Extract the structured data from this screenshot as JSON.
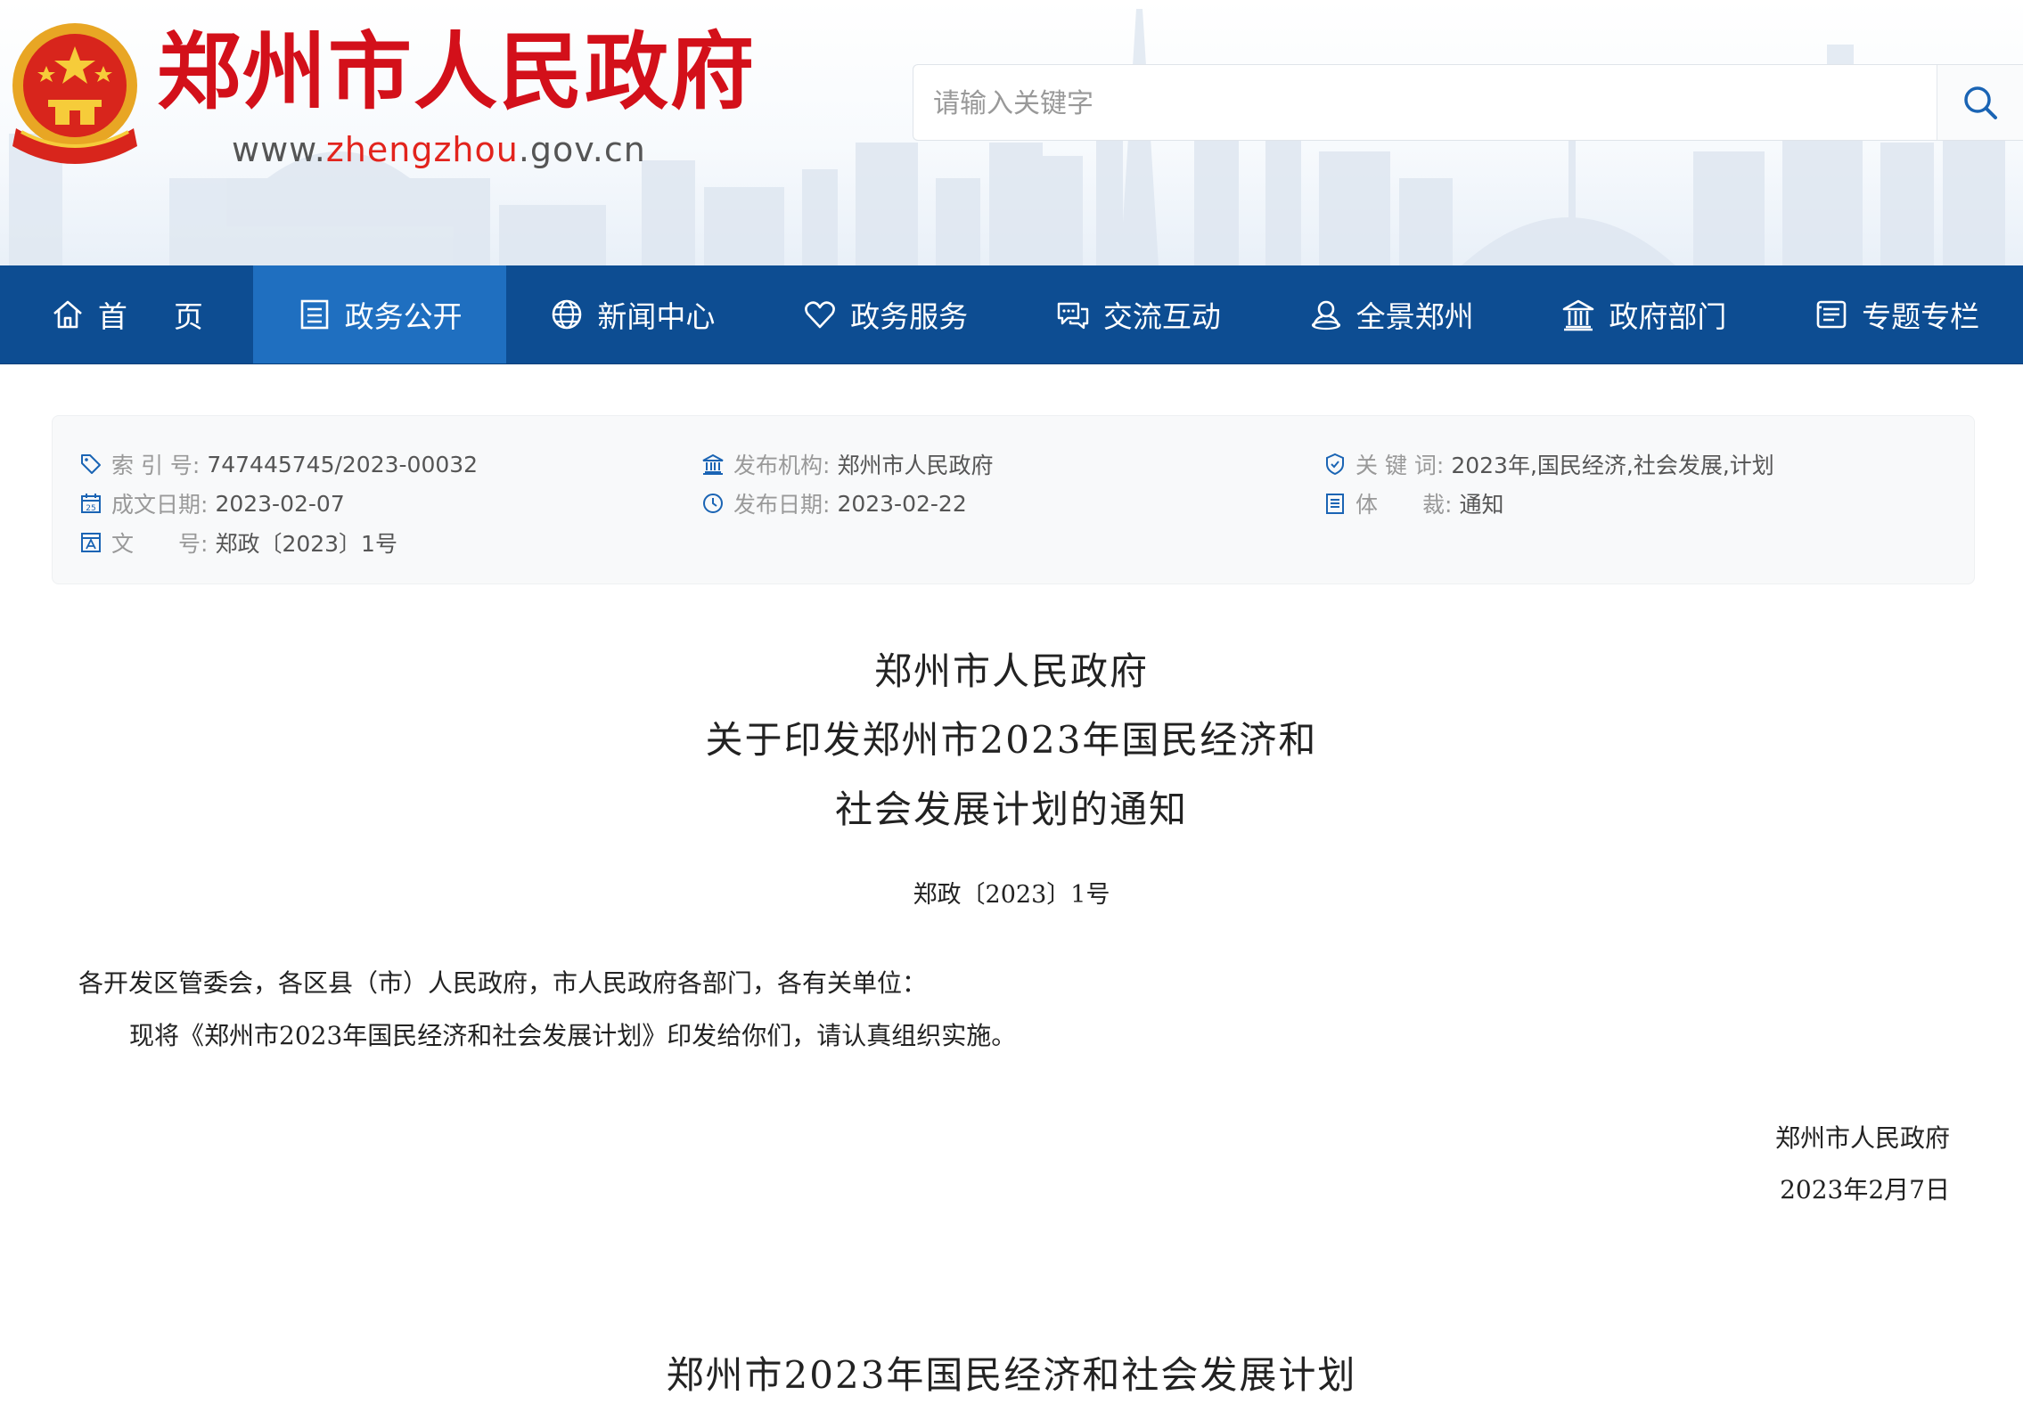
{
  "header": {
    "site_title": "郑州市人民政府",
    "url_prefix": "www.",
    "url_highlight": "zhengzhou",
    "url_suffix": ".gov.cn",
    "brand_red": "#d3101a"
  },
  "search": {
    "placeholder": "请输入关键字",
    "value": "",
    "icon": "search-icon"
  },
  "nav": {
    "bg_color": "#0d4d92",
    "active_color": "#1f6fc0",
    "items": [
      {
        "label": "首页",
        "icon": "home-icon"
      },
      {
        "label": "政务公开",
        "icon": "document-list-icon",
        "active": true
      },
      {
        "label": "新闻中心",
        "icon": "globe-icon"
      },
      {
        "label": "政务服务",
        "icon": "heart-icon"
      },
      {
        "label": "交流互动",
        "icon": "chat-bubbles-icon"
      },
      {
        "label": "全景郑州",
        "icon": "panorama-person-icon"
      },
      {
        "label": "政府部门",
        "icon": "government-building-icon"
      },
      {
        "label": "专题专栏",
        "icon": "columns-list-icon"
      }
    ]
  },
  "meta": {
    "index_label": "索 引 号:",
    "index_value": "747445745/2023-00032",
    "date_written_label": "成文日期:",
    "date_written_value": "2023-02-07",
    "doc_number_label": "文　　号:",
    "doc_number_value": "郑政〔2023〕1号",
    "publisher_label": "发布机构:",
    "publisher_value": "郑州市人民政府",
    "publish_date_label": "发布日期:",
    "publish_date_value": "2023-02-22",
    "keywords_label": "关 键 词:",
    "keywords_value": "2023年,国民经济,社会发展,计划",
    "genre_label": "体　　裁:",
    "genre_value": "通知"
  },
  "article": {
    "title_line1": "郑州市人民政府",
    "title_line2": "关于印发郑州市2023年国民经济和",
    "title_line3": "社会发展计划的通知",
    "doc_number": "郑政〔2023〕1号",
    "salutation": "各开发区管委会，各区县（市）人民政府，市人民政府各部门，各有关单位：",
    "body": "现将《郑州市2023年国民经济和社会发展计划》印发给你们，请认真组织实施。",
    "signer": "郑州市人民政府",
    "sign_date": "2023年2月7日",
    "attachment_title": "郑州市2023年国民经济和社会发展计划"
  }
}
